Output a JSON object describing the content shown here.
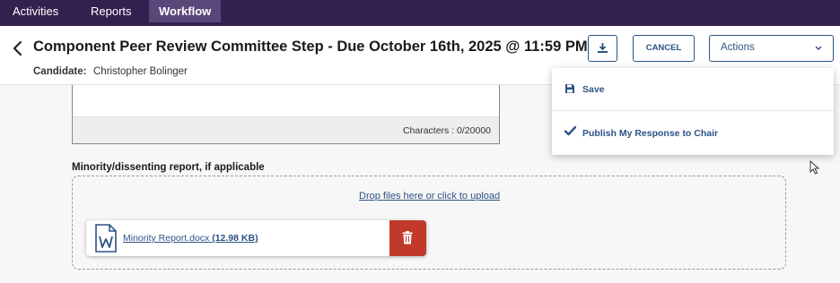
{
  "nav": {
    "tabs": [
      "Activities",
      "Reports",
      "Workflow"
    ],
    "active_tab": "Workflow"
  },
  "header": {
    "back_icon": "chevron-left-icon",
    "title": "Component Peer Review Committee Step - Due October 16th, 2025 @ 11:59 PM",
    "candidate_label": "Candidate:",
    "candidate_name": "Christopher Bolinger",
    "download_icon": "download-icon",
    "cancel_label": "CANCEL",
    "actions_label": "Actions"
  },
  "textarea": {
    "char_count": "Characters : 0/20000"
  },
  "minority": {
    "label": "Minority/dissenting report, if applicable",
    "drop_text": "Drop files here or click to upload",
    "file": {
      "name": "Minority Report.docx",
      "size": "(12.98 KB)",
      "icon": "word-document-icon",
      "delete_icon": "trash-icon"
    }
  },
  "actions_menu": {
    "items": [
      {
        "label": "Save",
        "icon": "save-icon"
      },
      {
        "label": "Publish My Response to Chair",
        "icon": "checkmark-icon"
      }
    ]
  },
  "colors": {
    "nav_bg": "#33204f",
    "nav_active": "#5b4679",
    "accent": "#2d5286",
    "danger": "#c0392b"
  }
}
